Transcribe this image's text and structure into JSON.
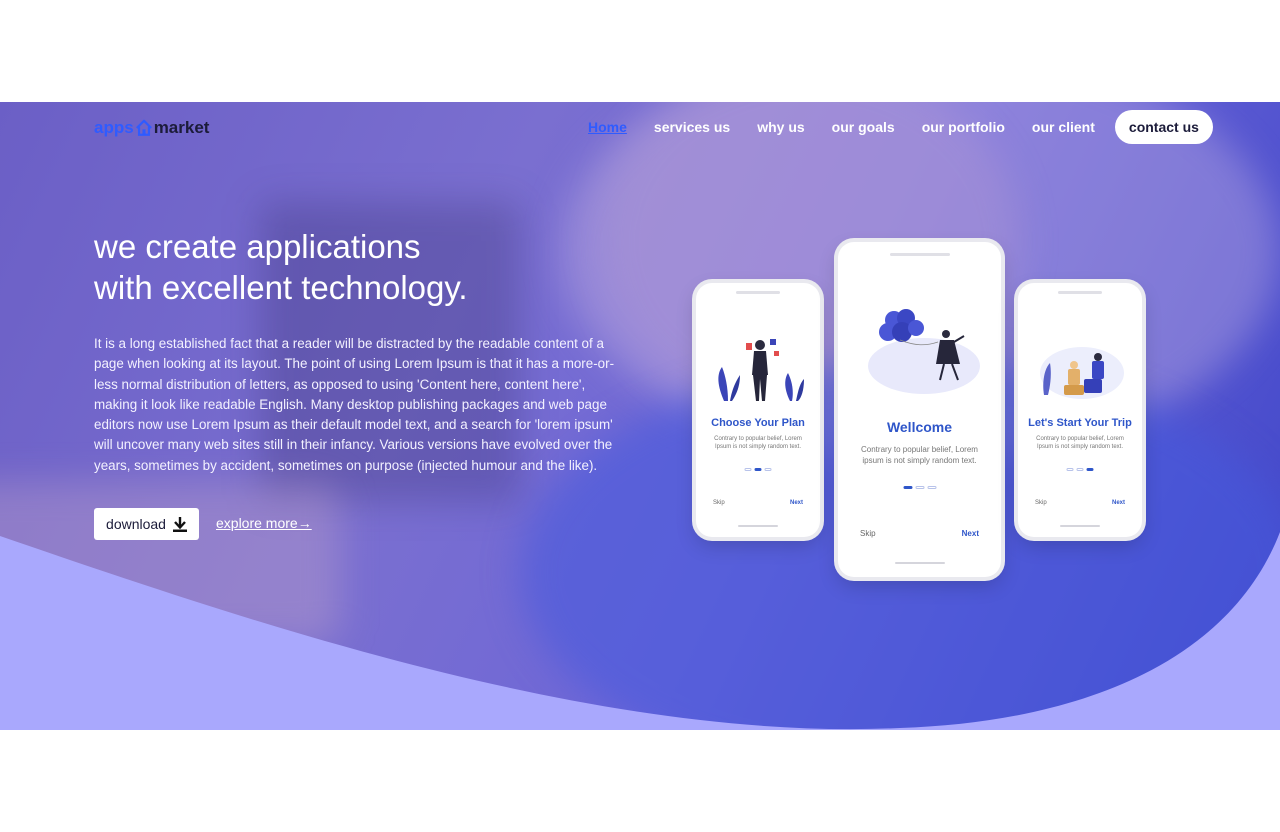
{
  "brand": {
    "part1": "apps",
    "part2": "market",
    "icon": "house-icon"
  },
  "nav": {
    "items": [
      {
        "label": "Home",
        "active": true
      },
      {
        "label": "services us"
      },
      {
        "label": "why us"
      },
      {
        "label": "our goals"
      },
      {
        "label": "our portfolio"
      },
      {
        "label": "our client"
      }
    ],
    "contact_label": "contact us"
  },
  "hero": {
    "headline_line1": "we create applications",
    "headline_line2": "with excellent technology.",
    "body": "It is a long established fact that a reader will be distracted by the readable content of a page when looking at its layout. The point of using Lorem Ipsum is that it has a more-or-less normal distribution of letters, as opposed to using 'Content here, content here', making it look like readable English. Many desktop publishing packages and web page editors now use Lorem Ipsum as their default model text, and a search for 'lorem ipsum' will uncover many web sites still in their infancy. Various versions have evolved over the years, sometimes by accident, sometimes on purpose (injected humour and the like).",
    "download_label": "download",
    "download_icon": "download-icon",
    "explore_label": "explore more→"
  },
  "phones": [
    {
      "title": "Choose Your Plan",
      "desc": "Contrary to popular belief, Lorem Ipsum is not simply random text.",
      "skip": "Skip",
      "next": "Next",
      "active_dot": 1
    },
    {
      "title": "Wellcome",
      "desc": "Contrary to popular belief, Lorem ipsum is not simply random text.",
      "skip": "Skip",
      "next": "Next",
      "active_dot": 0
    },
    {
      "title": "Let's Start Your Trip",
      "desc": "Contrary to popular belief, Lorem Ipsum is not simply random text.",
      "skip": "Skip",
      "next": "Next",
      "active_dot": 2
    }
  ],
  "colors": {
    "accent": "#2f5bff",
    "hero_purple": "#6b5fc6",
    "wave": "#a9a8fd",
    "phone_blue": "#2f56c9"
  }
}
